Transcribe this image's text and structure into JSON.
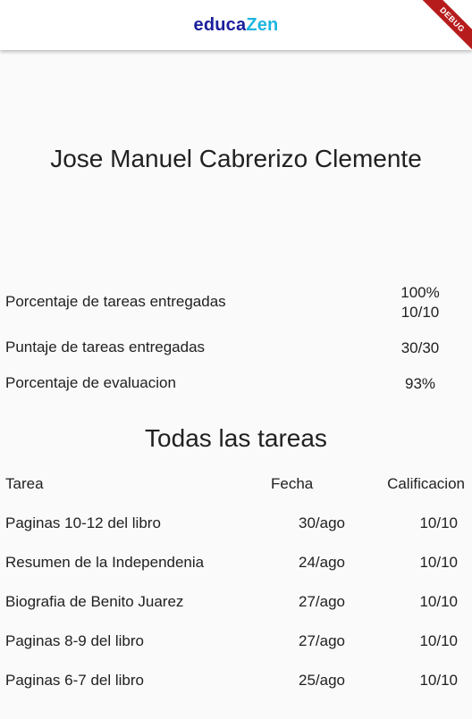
{
  "app": {
    "logo_part1": "educa",
    "logo_part2": "Zen",
    "debug_banner": "DEBUG"
  },
  "student": {
    "name": "Jose Manuel Cabrerizo Clemente"
  },
  "stats": [
    {
      "label": "Porcentaje de tareas entregadas",
      "value_line1": "100%",
      "value_line2": "10/10"
    },
    {
      "label": "Puntaje de tareas entregadas",
      "value": "30/30"
    },
    {
      "label": "Porcentaje de evaluacion",
      "value": "93%"
    }
  ],
  "tasks": {
    "title": "Todas las tareas",
    "headers": {
      "task": "Tarea",
      "date": "Fecha",
      "grade": "Calificacion"
    },
    "rows": [
      {
        "task": "Paginas 10-12 del libro",
        "date": "30/ago",
        "grade": "10/10"
      },
      {
        "task": "Resumen de la Independenia",
        "date": "24/ago",
        "grade": "10/10"
      },
      {
        "task": "Biografia de Benito Juarez",
        "date": "27/ago",
        "grade": "10/10"
      },
      {
        "task": "Paginas 8-9 del libro",
        "date": "27/ago",
        "grade": "10/10"
      },
      {
        "task": "Paginas 6-7 del libro",
        "date": "25/ago",
        "grade": "10/10"
      }
    ]
  },
  "colors": {
    "logo_dark": "#1a1f9c",
    "logo_light": "#1cb5e0",
    "background": "#fafafa",
    "debug_banner": "#b71c1c"
  }
}
